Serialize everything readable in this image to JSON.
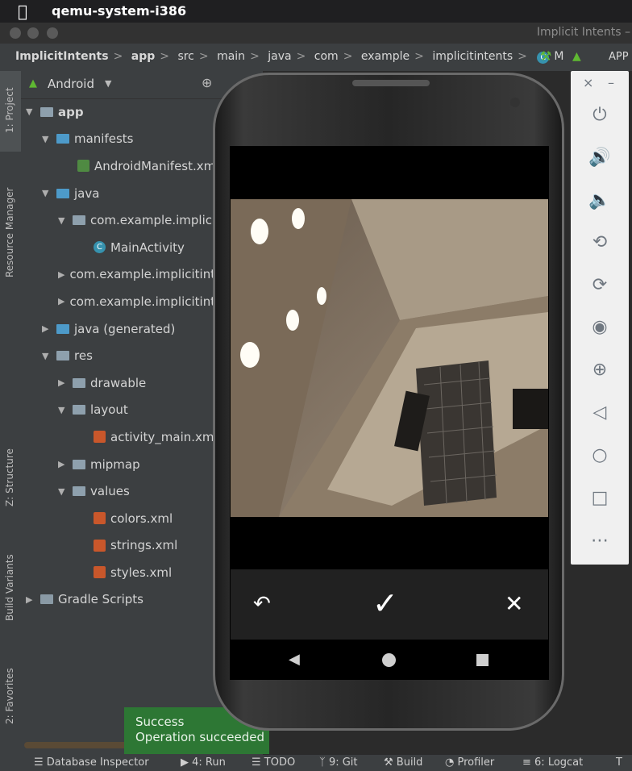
{
  "menubar": {
    "app_name": "qemu-system-i386"
  },
  "window": {
    "title": "Implicit Intents –"
  },
  "breadcrumb": {
    "items": [
      "ImplicitIntents",
      "app",
      "src",
      "main",
      "java",
      "com",
      "example",
      "implicitintents",
      "M"
    ],
    "trailing": "APP"
  },
  "left_tabs": [
    "1: Project",
    "Resource Manager",
    "Z: Structure",
    "Build Variants",
    "2: Favorites"
  ],
  "project": {
    "view_selector": "Android",
    "tree": [
      {
        "label": "app",
        "level": 0,
        "icon": "module-folder-icon",
        "expanded": true
      },
      {
        "label": "manifests",
        "level": 1,
        "icon": "folder-icon",
        "expanded": true
      },
      {
        "label": "AndroidManifest.xml",
        "level": 2,
        "icon": "manifest-file-icon"
      },
      {
        "label": "java",
        "level": 1,
        "icon": "folder-icon",
        "expanded": true
      },
      {
        "label": "com.example.implicitintents",
        "level": 2,
        "icon": "package-icon",
        "expanded": true
      },
      {
        "label": "MainActivity",
        "level": 3,
        "icon": "class-icon"
      },
      {
        "label": "com.example.implicitintents (androidTest)",
        "level": 2,
        "icon": "package-icon",
        "expanded": false
      },
      {
        "label": "com.example.implicitintents (test)",
        "level": 2,
        "icon": "package-icon",
        "expanded": false
      },
      {
        "label": "java (generated)",
        "level": 1,
        "icon": "generated-folder-icon",
        "expanded": false
      },
      {
        "label": "res",
        "level": 1,
        "icon": "res-folder-icon",
        "expanded": true
      },
      {
        "label": "drawable",
        "level": 2,
        "icon": "folder-icon",
        "expanded": false
      },
      {
        "label": "layout",
        "level": 2,
        "icon": "folder-icon",
        "expanded": true
      },
      {
        "label": "activity_main.xml",
        "level": 3,
        "icon": "xml-file-icon"
      },
      {
        "label": "mipmap",
        "level": 2,
        "icon": "folder-icon",
        "expanded": false
      },
      {
        "label": "values",
        "level": 2,
        "icon": "folder-icon",
        "expanded": true
      },
      {
        "label": "colors.xml",
        "level": 3,
        "icon": "xml-file-icon"
      },
      {
        "label": "strings.xml",
        "level": 3,
        "icon": "xml-file-icon"
      },
      {
        "label": "styles.xml",
        "level": 3,
        "icon": "xml-file-icon"
      },
      {
        "label": "Gradle Scripts",
        "level": 0,
        "icon": "gradle-icon",
        "expanded": false
      }
    ]
  },
  "toast": {
    "title": "Success",
    "message": "Operation succeeded"
  },
  "statusbar": {
    "items": [
      "Database Inspector",
      "4: Run",
      "TODO",
      "9: Git",
      "Build",
      "Profiler",
      "6: Logcat",
      "T"
    ]
  },
  "phone": {
    "camera_controls": {
      "retake": "undo-icon",
      "accept": "check-icon",
      "cancel": "close-icon"
    },
    "navbar": [
      "back-icon",
      "home-icon",
      "recents-icon"
    ]
  },
  "emulator_panel": {
    "window_controls": [
      "×",
      "–"
    ],
    "buttons": [
      "power-icon",
      "volume-up-icon",
      "volume-down-icon",
      "rotate-left-icon",
      "rotate-right-icon",
      "camera-icon",
      "zoom-icon",
      "back-icon",
      "home-icon",
      "overview-icon",
      "more-icon"
    ]
  },
  "colors": {
    "ide_panel": "#3c3f41",
    "editor": "#2b2b2b",
    "toast": "#2d7734",
    "emulator_panel": "#f0f0f0"
  }
}
